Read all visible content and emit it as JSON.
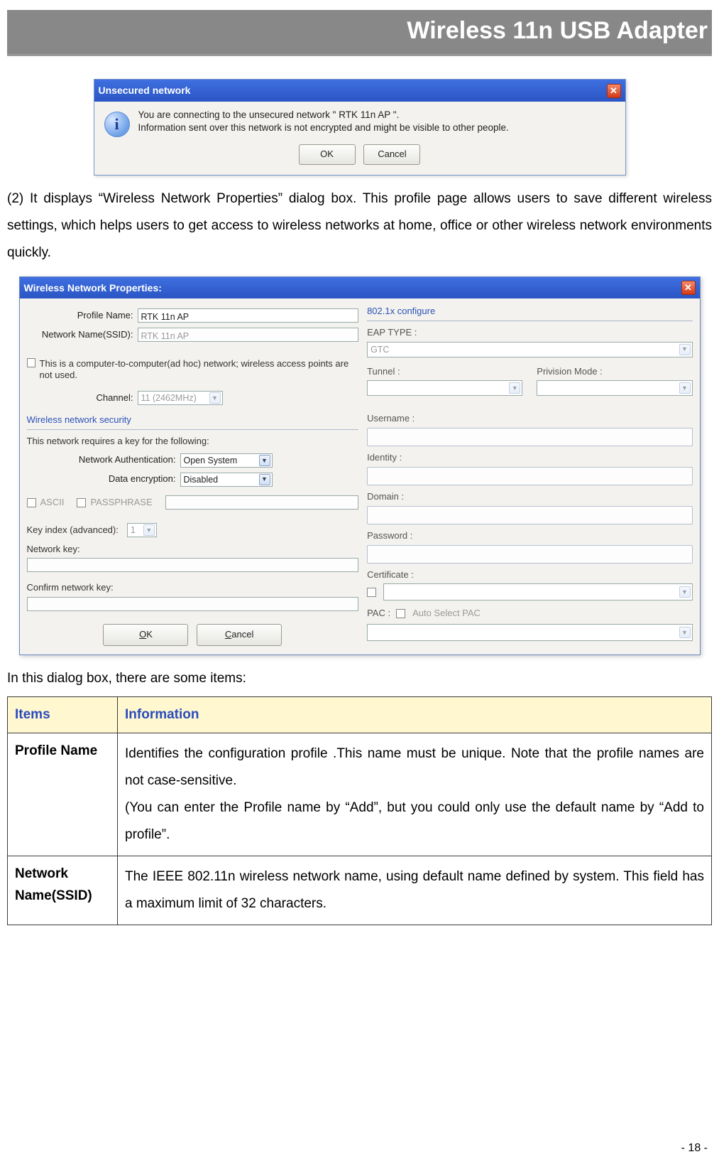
{
  "header": {
    "title": "Wireless 11n USB Adapter"
  },
  "dialog1": {
    "title": "Unsecured network",
    "close_glyph": "✕",
    "message_line1": "You are connecting to the unsecured network \" RTK 11n AP \".",
    "message_line2": "Information sent over this network is not encrypted and might be visible to other people.",
    "ok_label": "OK",
    "cancel_label": "Cancel"
  },
  "para2": "(2) It displays “Wireless Network Properties” dialog box. This profile page allows users to save different wireless settings, which helps users to get access to wireless networks at home, office or other wireless network environments quickly.",
  "dialog2": {
    "title": "Wireless Network Properties:",
    "close_glyph": "✕",
    "profile_name_label": "Profile Name:",
    "profile_name_value": "RTK 11n AP",
    "ssid_label": "Network Name(SSID):",
    "ssid_value": "RTK 11n AP",
    "adhoc_text": "This is a computer-to-computer(ad hoc) network; wireless access points are not used.",
    "channel_label": "Channel:",
    "channel_value": "11 (2462MHz)",
    "security_group": "Wireless network security",
    "security_intro": "This network requires a key for the following:",
    "auth_label": "Network Authentication:",
    "auth_value": "Open System",
    "enc_label": "Data encryption:",
    "enc_value": "Disabled",
    "ascii_label": "ASCII",
    "passphrase_label": "PASSPHRASE",
    "keyindex_label": "Key index (advanced):",
    "keyindex_value": "1",
    "netkey_label": "Network key:",
    "confirmkey_label": "Confirm network key:",
    "ok_label_u": "O",
    "ok_label_rest": "K",
    "cancel_label_u": "C",
    "cancel_label_rest": "ancel",
    "r_group": "802.1x configure",
    "r_eap_label": "EAP TYPE :",
    "r_eap_value": "GTC",
    "r_tunnel_label": "Tunnel :",
    "r_priv_label": "Privision Mode :",
    "r_username_label": "Username :",
    "r_identity_label": "Identity :",
    "r_domain_label": "Domain :",
    "r_password_label": "Password :",
    "r_cert_label": "Certificate :",
    "r_pac_label": "PAC :",
    "r_autopac_label": "Auto Select PAC"
  },
  "para3": "In this dialog box, there are some items:",
  "table": {
    "head_items": "Items",
    "head_info": "Information",
    "rows": [
      {
        "item": "Profile Name",
        "info": "Identifies the configuration profile .This name must be unique. Note that the profile names are not case-sensitive.\n(You can enter the Profile name by “Add”, but you could only use the default name by “Add to profile”."
      },
      {
        "item": "Network Name(SSID)",
        "info": "The IEEE 802.11n wireless network name, using default name defined by system. This field has a maximum limit of 32 characters."
      }
    ]
  },
  "footer": "- 18 -"
}
